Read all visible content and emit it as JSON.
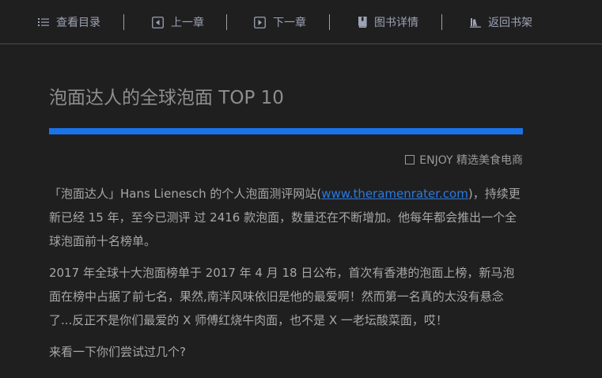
{
  "nav": {
    "toc_label": "查看目录",
    "prev_label": "上一章",
    "next_label": "下一章",
    "details_label": "图书详情",
    "shelf_label": "返回书架"
  },
  "article": {
    "title": "泡面达人的全球泡面 TOP 10",
    "source": "ENJOY 精选美食电商",
    "p1_before": "「泡面达人」Hans Lienesch 的个人泡面测评网站(",
    "p1_link": "www.theramenrater.com",
    "p1_after": ")，持续更新已经 15 年，至今已测评 过 2416 款泡面，数量还在不断增加。他每年都会推出一个全球泡面前十名榜单。",
    "p2": "2017 年全球十大泡面榜单于 2017 年 4 月 18 日公布，首次有香港的泡面上榜，新马泡面在榜中占据了前七名，果然,南洋风味依旧是他的最爱啊！然而第一名真的太没有悬念了...反正不是你们最爱的 X 师傅红烧牛肉面，也不是 X 一老坛酸菜面，哎！",
    "p3": "来看一下你们尝试过几个?"
  },
  "colors": {
    "background": "#1f1f20",
    "accent_rule": "#1a73e8",
    "link": "#2a7ae2",
    "nav_text": "#9da3b4"
  },
  "icons": {
    "toc": "list-icon",
    "prev": "prev-chapter-icon",
    "next": "next-chapter-icon",
    "details": "book-icon",
    "shelf": "bookshelf-icon"
  }
}
